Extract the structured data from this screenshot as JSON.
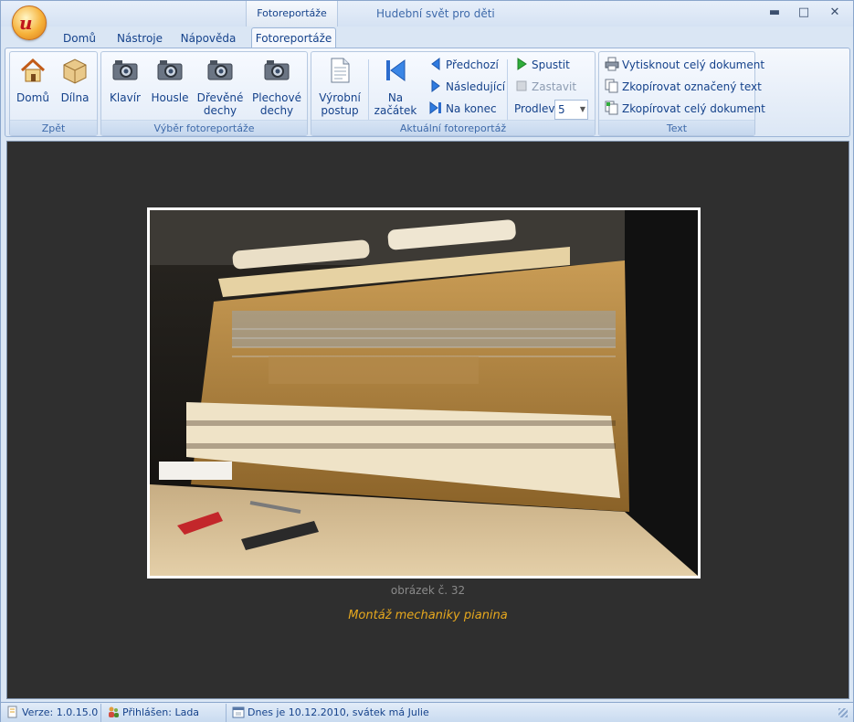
{
  "window": {
    "app_title": "Hudební svět pro děti",
    "context_tab_header": "Fotoreportáže",
    "minimize": "▬",
    "maximize": "□",
    "close": "✕"
  },
  "tabs": [
    {
      "label": "Domů"
    },
    {
      "label": "Nástroje"
    },
    {
      "label": "Nápověda"
    },
    {
      "label": "Fotoreportáže",
      "active": true
    }
  ],
  "ribbon": {
    "groups": {
      "zpet": {
        "label": "Zpět",
        "buttons": [
          "Domů",
          "Dílna"
        ]
      },
      "vyber": {
        "label": "Výběr fotoreportáže",
        "buttons": [
          "Klavír",
          "Housle",
          "Dřevěné dechy",
          "Plechové dechy"
        ]
      },
      "aktualni": {
        "label": "Aktuální fotoreportáž",
        "vyrobni_postup": "Výrobní postup",
        "na_zacatek": "Na začátek",
        "predchozi": "Předchozí",
        "nasledujici": "Následující",
        "na_konec": "Na konec",
        "spustit": "Spustit",
        "zastavit": "Zastavit",
        "prodleva_label": "Prodleva",
        "prodleva_value": "5"
      },
      "text": {
        "label": "Text",
        "print": "Vytisknout celý dokument",
        "copy_selected": "Zkopírovat označený text",
        "copy_all": "Zkopírovat celý dokument"
      }
    }
  },
  "content": {
    "image_number": "obrázek č. 32",
    "caption": "Montáž mechaniky pianina"
  },
  "statusbar": {
    "version": "Verze: 1.0.15.0",
    "user": "Přihlášen: Lada",
    "date": "Dnes je 10.12.2010, svátek má Julie"
  },
  "colors": {
    "caption": "#e7a81e",
    "content_bg": "#2f2f2f",
    "ribbon_text": "#15428b"
  }
}
